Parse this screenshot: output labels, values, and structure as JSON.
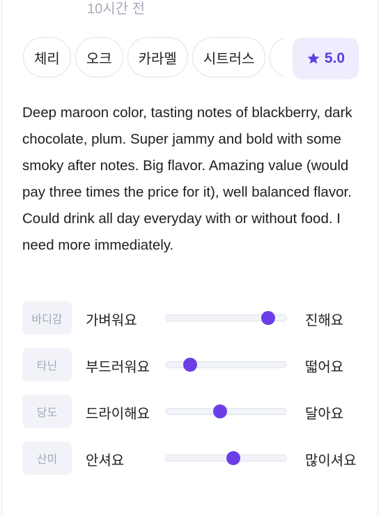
{
  "header": {
    "time_ago": "10시간 전"
  },
  "tags": [
    "체리",
    "오크",
    "카라멜",
    "시트러스",
    ""
  ],
  "rating": {
    "value": "5.0",
    "color": "#5a3fe0"
  },
  "review_text": "Deep maroon color, tasting notes of blackberry, dark chocolate, plum. Super jammy and bold with some smoky after notes. Big flavor. Amazing value (would pay three times the price for it), well balanced flavor. Could drink all day everyday with or without food. I need more immediately.",
  "characteristics": [
    {
      "name": "바디감",
      "left": "가벼워요",
      "right": "진해요",
      "level": 0.85
    },
    {
      "name": "타닌",
      "left": "부드러워요",
      "right": "떫어요",
      "level": 0.2
    },
    {
      "name": "당도",
      "left": "드라이해요",
      "right": "달아요",
      "level": 0.45
    },
    {
      "name": "산미",
      "left": "안셔요",
      "right": "많이셔요",
      "level": 0.56
    }
  ],
  "colors": {
    "accent": "#6b3ee8",
    "badge_bg": "#f1f3f8"
  }
}
